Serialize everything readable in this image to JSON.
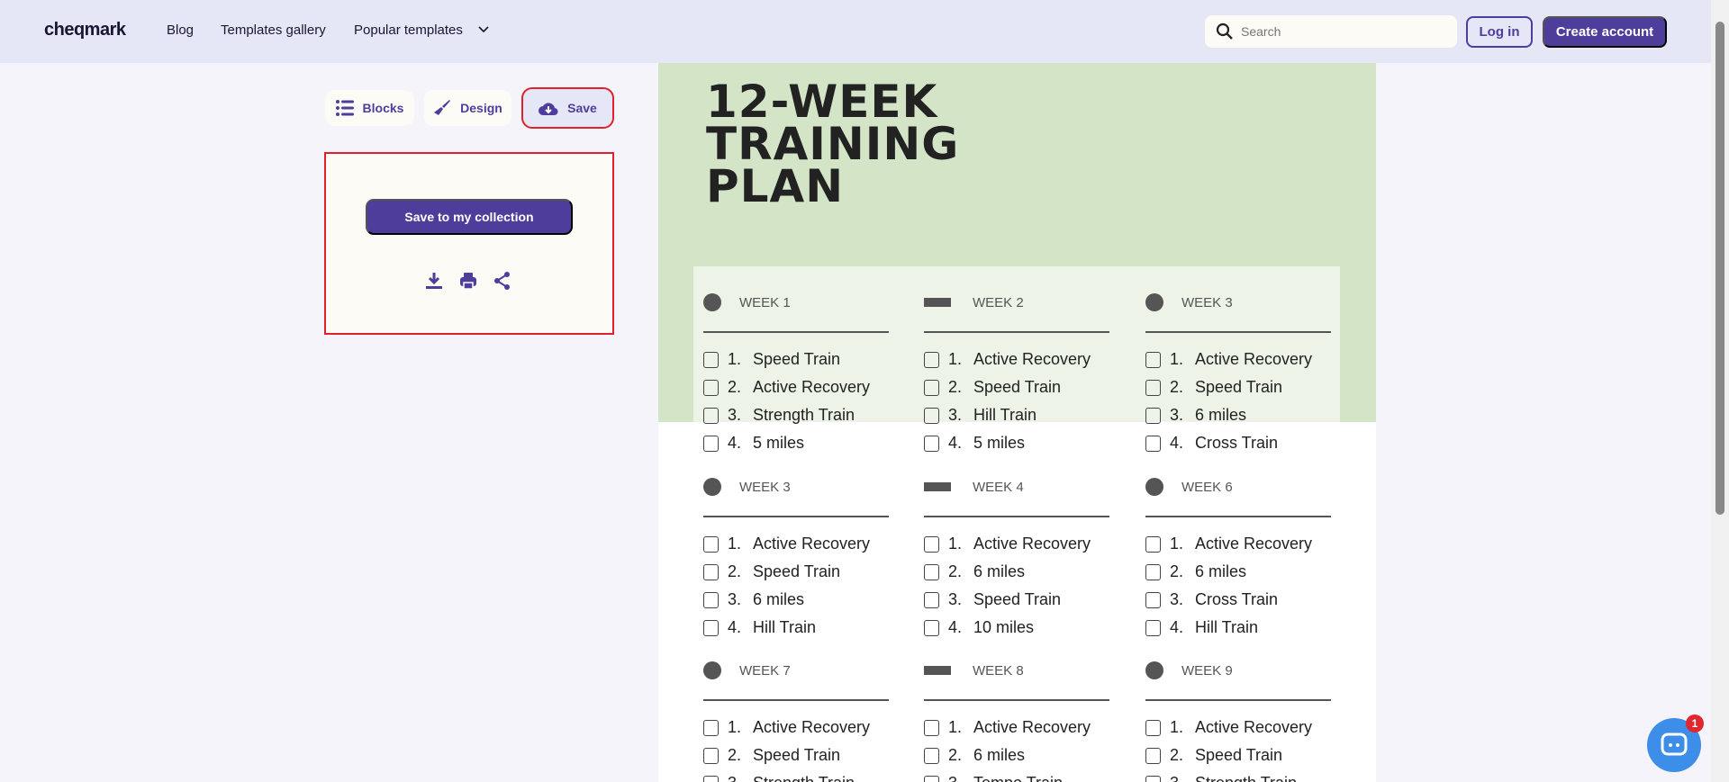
{
  "header": {
    "logo": "cheqmark",
    "nav": [
      "Blog",
      "Templates gallery",
      "Popular templates"
    ],
    "search_placeholder": "Search",
    "login": "Log in",
    "create_account": "Create account"
  },
  "toolbar": {
    "blocks": "Blocks",
    "design": "Design",
    "save": "Save"
  },
  "save_panel": {
    "save_collection": "Save to my collection"
  },
  "document": {
    "title": "12-WEEK TRAINING PLAN",
    "weeks": [
      {
        "label": "WEEK 1",
        "marker": "circle",
        "items": [
          "Speed Train",
          "Active Recovery",
          "Strength Train",
          "5 miles"
        ]
      },
      {
        "label": "WEEK 2",
        "marker": "rect",
        "items": [
          "Active Recovery",
          "Speed Train",
          "Hill Train",
          "5 miles"
        ]
      },
      {
        "label": "WEEK 3",
        "marker": "circle",
        "items": [
          "Active Recovery",
          "Speed Train",
          "6 miles",
          "Cross Train"
        ]
      },
      {
        "label": "WEEK 3",
        "marker": "circle",
        "items": [
          "Active Recovery",
          "Speed Train",
          "6 miles",
          "Hill Train"
        ]
      },
      {
        "label": "WEEK 4",
        "marker": "rect",
        "items": [
          "Active Recovery",
          "6 miles",
          "Speed Train",
          "10 miles"
        ]
      },
      {
        "label": "WEEK 6",
        "marker": "circle",
        "items": [
          "Active Recovery",
          "6 miles",
          "Cross Train",
          "Hill Train"
        ]
      },
      {
        "label": "WEEK 7",
        "marker": "circle",
        "items": [
          "Active Recovery",
          "Speed Train",
          "Strength Train"
        ]
      },
      {
        "label": "WEEK 8",
        "marker": "rect",
        "items": [
          "Active Recovery",
          "6 miles",
          "Tempo Train"
        ]
      },
      {
        "label": "WEEK 9",
        "marker": "circle",
        "items": [
          "Active Recovery",
          "Speed Train",
          "Strength Train"
        ]
      }
    ]
  },
  "chat": {
    "badge": "1"
  },
  "colors": {
    "accent": "#4f3d9c",
    "header_bg": "#e5e6f6",
    "doc_green": "#d4e5c7",
    "highlight": "#e0202a"
  }
}
